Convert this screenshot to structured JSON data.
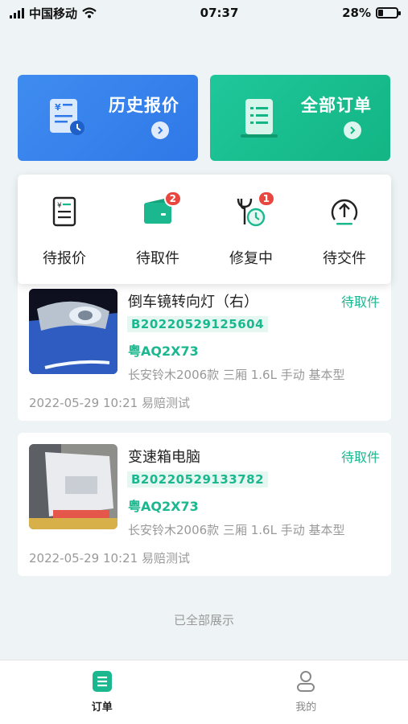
{
  "status_bar": {
    "carrier": "中国移动",
    "time": "07:37",
    "battery": "28%",
    "battery_level": 0.28
  },
  "top_cards": [
    {
      "title": "历史报价"
    },
    {
      "title": "全部订单"
    }
  ],
  "statuses": [
    {
      "label": "待报价",
      "badge": null
    },
    {
      "label": "待取件",
      "badge": "2"
    },
    {
      "label": "修复中",
      "badge": "1"
    },
    {
      "label": "待交件",
      "badge": null
    }
  ],
  "orders": [
    {
      "title": "倒车镜转向灯（右）",
      "status": "待取件",
      "code": "B20220529125604",
      "plate": "粤AQ2X73",
      "model": "长安铃木2006款 三厢 1.6L 手动 基本型",
      "datetime": "2022-05-29 10:21",
      "note": "易赔测试"
    },
    {
      "title": "变速箱电脑",
      "status": "待取件",
      "code": "B20220529133782",
      "plate": "粤AQ2X73",
      "model": "长安铃木2006款 三厢 1.6L 手动 基本型",
      "datetime": "2022-05-29 10:21",
      "note": "易赔测试"
    }
  ],
  "end_text": "已全部展示",
  "tabs": [
    {
      "label": "订单"
    },
    {
      "label": "我的"
    }
  ],
  "colors": {
    "accent": "#1bb88f",
    "blue": "#3a86ee",
    "badge": "#e8473f"
  }
}
